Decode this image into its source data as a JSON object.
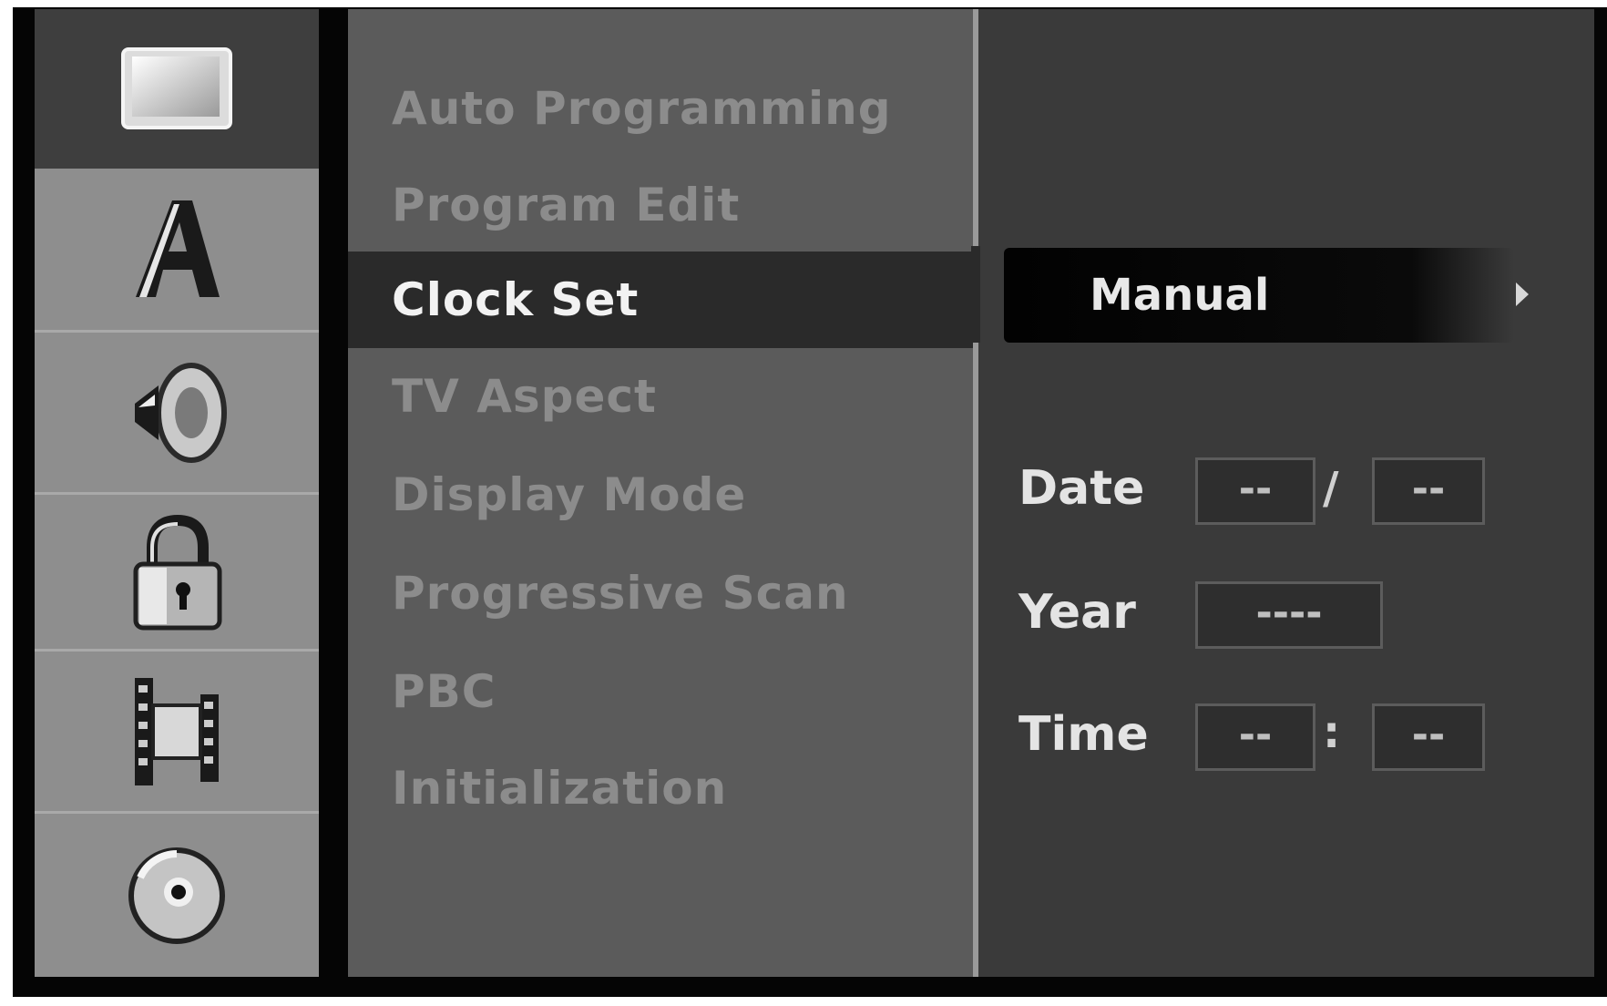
{
  "sidebar": {
    "icons": [
      {
        "name": "tv-screen-icon",
        "active": true
      },
      {
        "name": "language-a-icon",
        "active": false
      },
      {
        "name": "speaker-audio-icon",
        "active": false
      },
      {
        "name": "lock-icon",
        "active": false
      },
      {
        "name": "film-recording-icon",
        "active": false
      },
      {
        "name": "disc-icon",
        "active": false
      }
    ]
  },
  "menu": {
    "items": [
      {
        "label": "Auto Programming",
        "selected": false
      },
      {
        "label": "Program Edit",
        "selected": false
      },
      {
        "label": "Clock Set",
        "selected": true
      },
      {
        "label": "TV Aspect",
        "selected": false
      },
      {
        "label": "Display Mode",
        "selected": false
      },
      {
        "label": "Progressive Scan",
        "selected": false
      },
      {
        "label": "PBC",
        "selected": false
      },
      {
        "label": "Initialization",
        "selected": false
      }
    ]
  },
  "clock": {
    "mode_label": "Manual",
    "date_label": "Date",
    "year_label": "Year",
    "time_label": "Time",
    "date_month": "--",
    "date_separator": "/",
    "date_day": "--",
    "year_value": "----",
    "time_hour": "--",
    "time_separator": ":",
    "time_minute": "--"
  },
  "colors": {
    "menu_bg": "#5b5b5b",
    "selected_bg": "#2a2a2a",
    "icon_col_bg": "#8e8e8e",
    "right_panel_bg": "#3a3a3a"
  }
}
